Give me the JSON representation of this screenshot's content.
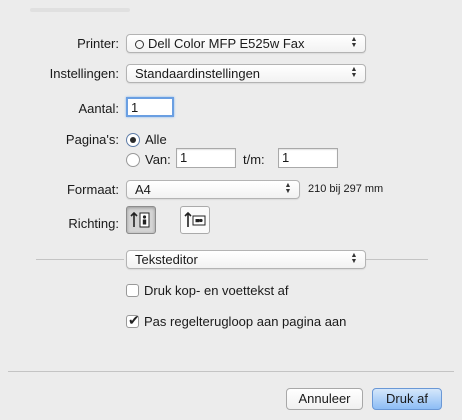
{
  "printer": {
    "label": "Printer:",
    "value": "Dell Color MFP E525w Fax"
  },
  "presets": {
    "label": "Instellingen:",
    "value": "Standaardinstellingen"
  },
  "copies": {
    "label": "Aantal:",
    "value": "1"
  },
  "pages": {
    "label": "Pagina's:",
    "all_label": "Alle",
    "from_label": "Van:",
    "from_value": "1",
    "to_label": "t/m:",
    "to_value": "1"
  },
  "paper": {
    "label": "Formaat:",
    "value": "A4",
    "size_text": "210 bij 297 mm"
  },
  "orientation": {
    "label": "Richting:"
  },
  "app_section": {
    "value": "Teksteditor"
  },
  "options": {
    "header_footer_label": "Druk kop- en voettekst af",
    "header_footer_checked": false,
    "rewrap_label": "Pas regelterugloop aan pagina aan",
    "rewrap_checked": true
  },
  "buttons": {
    "cancel": "Annuleer",
    "print": "Druk af"
  }
}
